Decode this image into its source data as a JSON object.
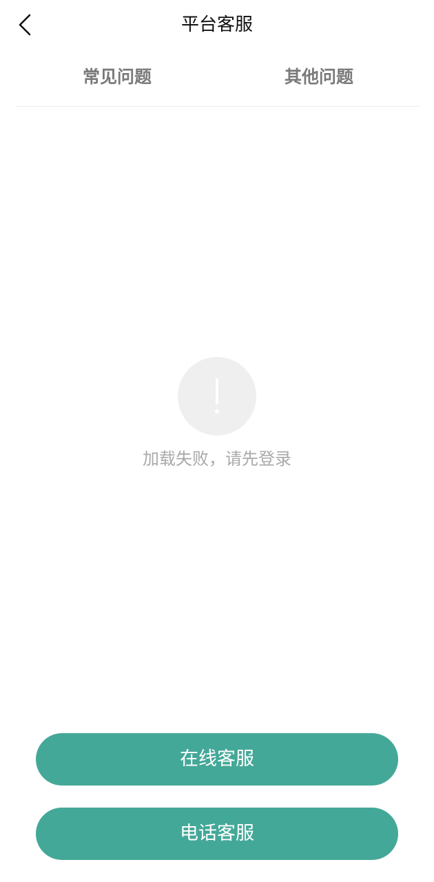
{
  "header": {
    "back_icon": "chevron-left-icon",
    "title": "平台客服"
  },
  "tabs": [
    {
      "label": "常见问题"
    },
    {
      "label": "其他问题"
    }
  ],
  "empty_state": {
    "icon": "exclamation-icon",
    "message": "加载失败，请先登录"
  },
  "actions": {
    "online_label": "在线客服",
    "phone_label": "电话客服"
  },
  "colors": {
    "accent": "#44a898",
    "tab_text": "#7a7a7a",
    "empty_text": "#a9a9a9",
    "empty_circle": "#efefef"
  }
}
